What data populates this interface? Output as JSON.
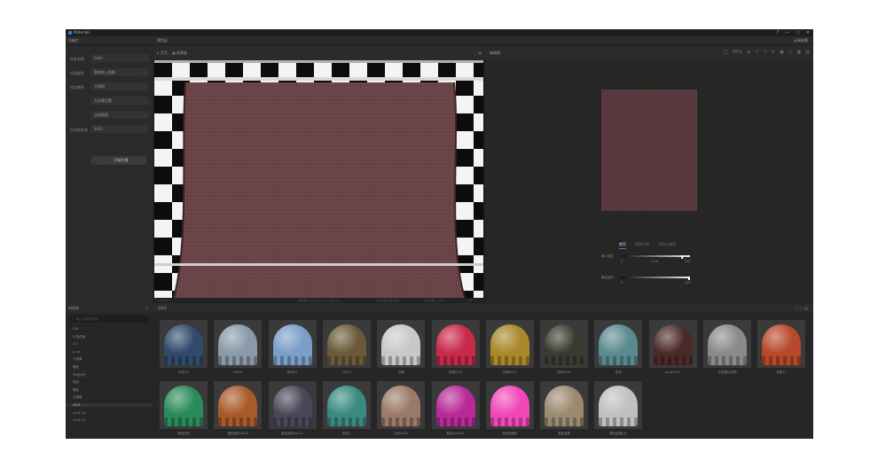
{
  "app": {
    "title": "Materials"
  },
  "window_controls": [
    "?",
    "—",
    "▭",
    "✕"
  ],
  "sections": {
    "left": "功能栏",
    "center": "预览区",
    "right_action": "云端收藏"
  },
  "form": {
    "fields": [
      {
        "label": "任务名称",
        "value": "hello"
      },
      {
        "label": "任务类型",
        "value": "图像转入图像"
      },
      {
        "label": "任务属性",
        "value": "不透明"
      },
      {
        "label": "",
        "value": "无金属设置"
      },
      {
        "label": "",
        "value": "全部贴图"
      },
      {
        "label": "任务保存到",
        "value": "2021"
      }
    ],
    "start_button": "开始扫描"
  },
  "viewport": {
    "breadcrumb_home": "主页",
    "breadcrumb_item": "贴图板",
    "status_left": "9:48 T 0 F",
    "status_items": [
      "当前材质: 2021-09(8:0) 7 材 0 包",
      "显示材质(当前(平面))",
      "显示光照: 0 lx/m²",
      "LOD"
    ]
  },
  "preview": {
    "title": "缩略图",
    "zoom": "60%"
  },
  "tabs": [
    "颜色",
    "高度平衡",
    "增强与减弱"
  ],
  "active_tab": 0,
  "sliders": [
    {
      "label": "输入色阶",
      "ticks": [
        "0",
        "1.00",
        "255"
      ],
      "level": 0.9
    },
    {
      "label": "输出色阶",
      "ticks": [
        "0",
        "255"
      ],
      "level": 1.0
    }
  ],
  "library": {
    "title": "材质库",
    "folder": "2021",
    "search_placeholder": "输入关键字搜索",
    "tree": [
      "CJH",
      "X-测试版",
      "X-4",
      "▸ cut",
      "人造革",
      "格纹",
      "羊毛针织",
      "布纹",
      "素色",
      "沙滩面",
      "2021",
      "2021-10",
      "2021-11"
    ],
    "selected_tree": 10
  },
  "materials": [
    {
      "name": "针织15",
      "color": "#2f4a6a"
    },
    {
      "name": "P0091",
      "color": "#8a9aa8"
    },
    {
      "name": "拼布01",
      "color": "#7a9ec8"
    },
    {
      "name": "13221",
      "color": "#6a5a3a"
    },
    {
      "name": "白绸",
      "color": "#c8c8c8"
    },
    {
      "name": "丝绸0012",
      "color": "#c8284a"
    },
    {
      "name": "丝绸0022",
      "color": "#a8882a"
    },
    {
      "name": "豹纹0001",
      "color": "#3a3a30"
    },
    {
      "name": "布纹",
      "color": "#5a8a90"
    },
    {
      "name": "brown101",
      "color": "#4a2a28"
    },
    {
      "name": "灰色蕾丝织物",
      "color": "#8a8a8a"
    },
    {
      "name": "皮革12",
      "color": "#b8482a"
    },
    {
      "name": "绿色针织",
      "color": "#2a8a5a"
    },
    {
      "name": "橘色面料(OF-8",
      "color": "#a85a2a"
    },
    {
      "name": "紫色面料(N-3-2",
      "color": "#4a4858"
    },
    {
      "name": "条纹1",
      "color": "#3a8a80"
    },
    {
      "name": "毛料2022",
      "color": "#9a7a68"
    },
    {
      "name": "紫色velvet1",
      "color": "#b82a98"
    },
    {
      "name": "亮粉色面料",
      "color": "#f048b8"
    },
    {
      "name": "银色金属",
      "color": "#9a8a70"
    },
    {
      "name": "银色金属(大)",
      "color": "#c0c0c0"
    }
  ],
  "colors": {
    "accent": "#2b7de9",
    "leather": "#6a4448"
  }
}
